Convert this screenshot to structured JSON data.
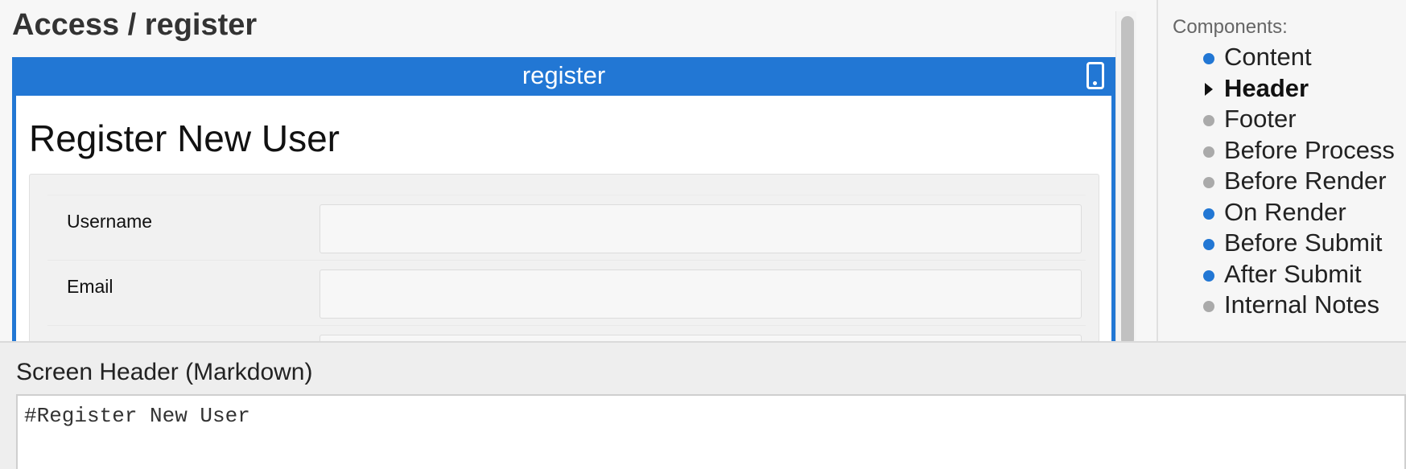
{
  "page": {
    "title": "Access / register"
  },
  "preview": {
    "frame_title": "register",
    "screen_heading": "Register New User",
    "fields": [
      {
        "label": "Username",
        "value": ""
      },
      {
        "label": "Email",
        "value": ""
      },
      {
        "label": "",
        "value": ""
      }
    ]
  },
  "components": {
    "title": "Components:",
    "items": [
      {
        "label": "Content",
        "marker": "dot",
        "color": "#2277d4"
      },
      {
        "label": "Header",
        "marker": "caret",
        "active": true
      },
      {
        "label": "Footer",
        "marker": "dot",
        "color": "#aaaaaa"
      },
      {
        "label": "Before Process",
        "marker": "dot",
        "color": "#aaaaaa"
      },
      {
        "label": "Before Render",
        "marker": "dot",
        "color": "#aaaaaa"
      },
      {
        "label": "On Render",
        "marker": "dot",
        "color": "#2277d4"
      },
      {
        "label": "Before Submit",
        "marker": "dot",
        "color": "#2277d4"
      },
      {
        "label": "After Submit",
        "marker": "dot",
        "color": "#2277d4"
      },
      {
        "label": "Internal Notes",
        "marker": "dot",
        "color": "#aaaaaa"
      }
    ]
  },
  "editor": {
    "title": "Screen Header (Markdown)",
    "content": "#Register New User"
  },
  "colors": {
    "accent": "#2277d4",
    "inactive": "#aaaaaa"
  }
}
